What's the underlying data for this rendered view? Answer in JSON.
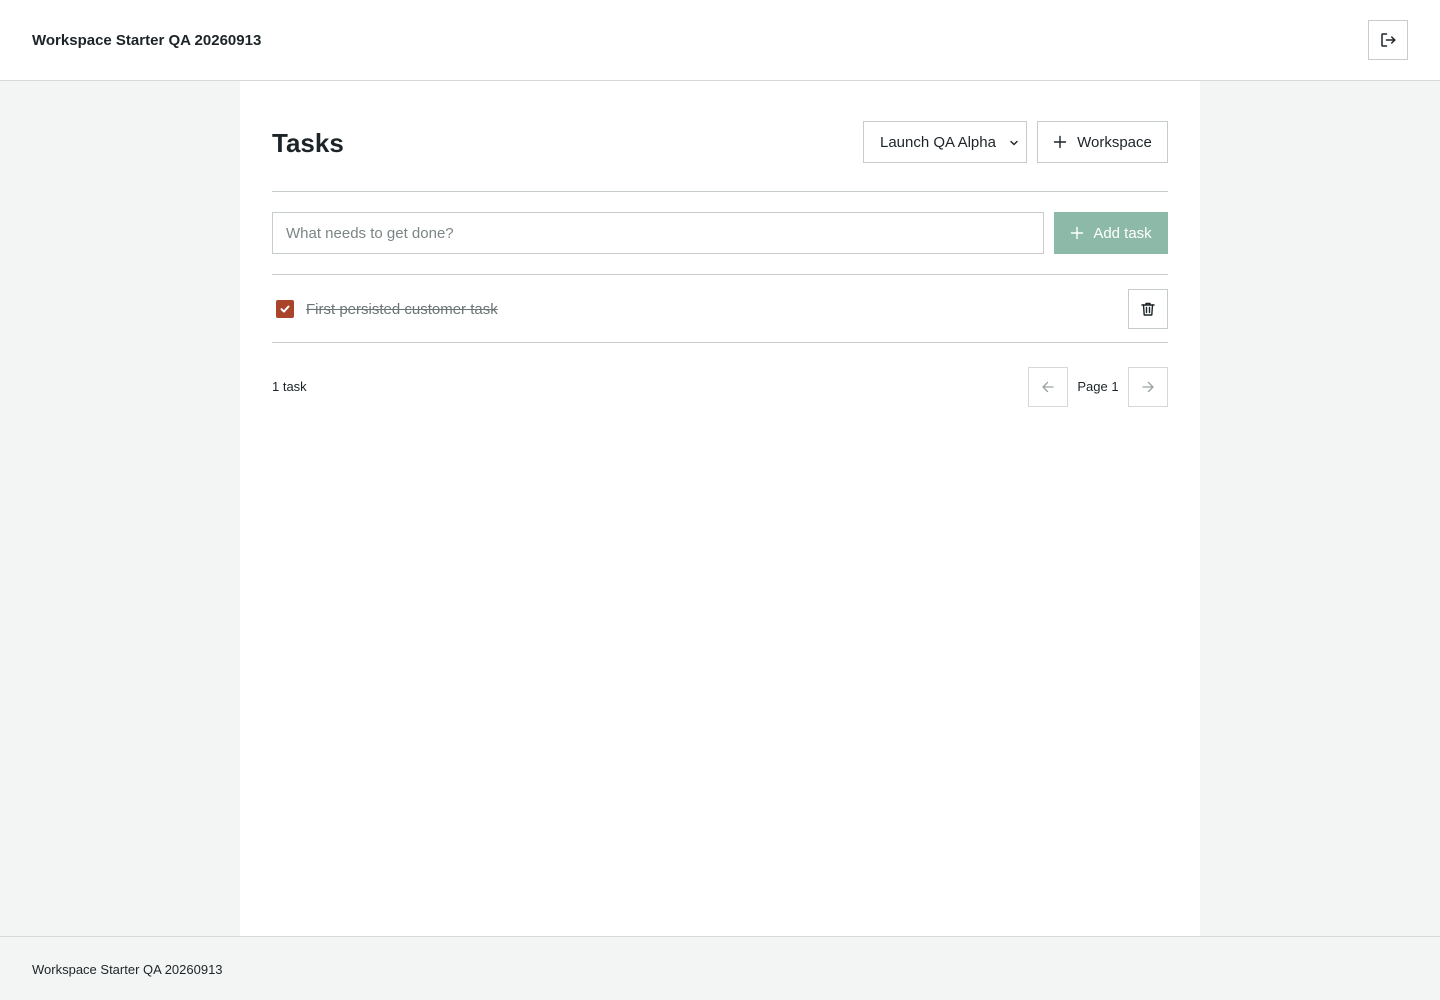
{
  "header": {
    "app_title": "Workspace Starter QA 20260913",
    "logout_icon": "logout-icon"
  },
  "main": {
    "title": "Tasks",
    "workspace_select": {
      "selected": "Launch QA Alpha",
      "icon": "chevron-down-icon"
    },
    "add_workspace_button": {
      "label": "Workspace",
      "icon": "plus-icon"
    },
    "new_task": {
      "placeholder": "What needs to get done?",
      "value": "",
      "add_button_label": "Add task",
      "add_button_icon": "plus-icon",
      "add_button_color": "#8db9a8"
    },
    "tasks": [
      {
        "text": "First persisted customer task",
        "completed": true,
        "check_color": "#a9432a",
        "delete_icon": "trash-icon"
      }
    ],
    "task_count": "1 task",
    "pagination": {
      "prev_icon": "arrow-left-icon",
      "page_label": "Page 1",
      "next_icon": "arrow-right-icon"
    }
  },
  "footer": {
    "text": "Workspace Starter QA 20260913"
  }
}
